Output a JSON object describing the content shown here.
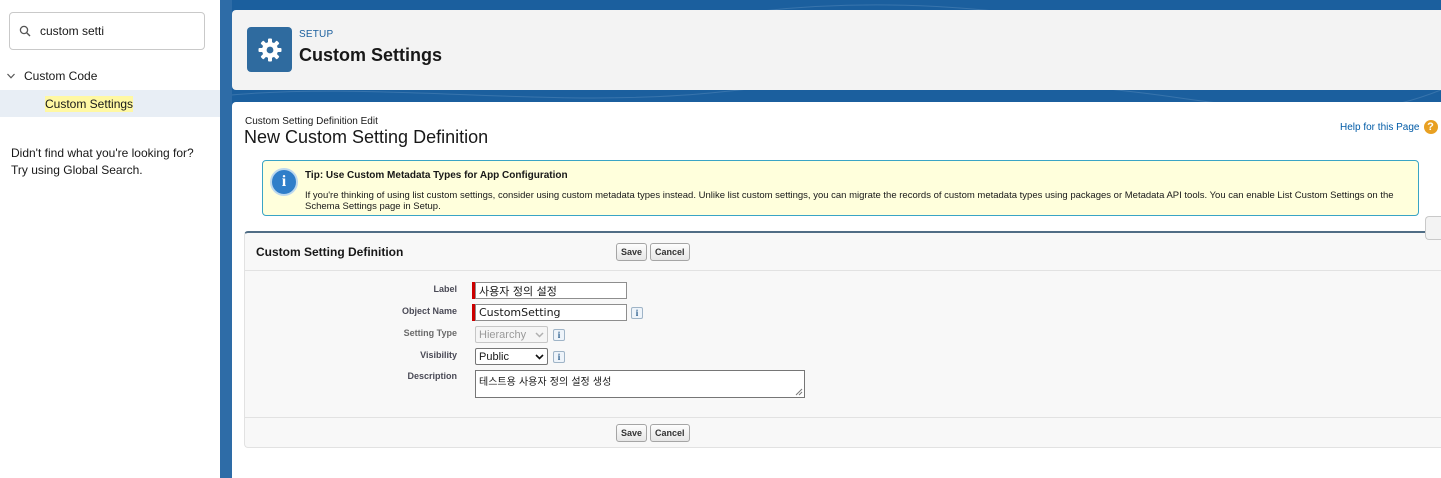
{
  "sidebar": {
    "search_value": "custom setti",
    "tree_parent_label": "Custom Code",
    "tree_child_label": "Custom Settings",
    "not_found_line1": "Didn't find what you're looking for?",
    "not_found_line2": "Try using Global Search."
  },
  "header": {
    "eyebrow": "SETUP",
    "title": "Custom Settings",
    "icon": "gear-icon"
  },
  "page": {
    "breadcrumb": "Custom Setting Definition Edit",
    "title": "New Custom Setting Definition",
    "help_link": "Help for this Page",
    "help_icon": "?"
  },
  "tip": {
    "title": "Tip: Use Custom Metadata Types for App Configuration",
    "text": "If you're thinking of using list custom settings, consider using custom metadata types instead. Unlike list custom settings, you can migrate the records of custom metadata types using packages or Metadata API tools. You can enable List Custom Settings on the Schema Settings page in Setup.",
    "icon_glyph": "i"
  },
  "form": {
    "section_title": "Custom Setting Definition",
    "save_label": "Save",
    "cancel_label": "Cancel",
    "fields": {
      "label": {
        "label": "Label",
        "value": "사용자 정의 설정"
      },
      "object_name": {
        "label": "Object Name",
        "value": "CustomSetting"
      },
      "setting_type": {
        "label": "Setting Type",
        "value": "Hierarchy"
      },
      "visibility": {
        "label": "Visibility",
        "value": "Public"
      },
      "description": {
        "label": "Description",
        "value": "테스트용 사용자 정의 설정 생성"
      }
    },
    "info_glyph": "i"
  },
  "colors": {
    "brand_blue": "#1b5f9e",
    "header_icon_bg": "#2f6b9f",
    "tip_bg": "#ffffdc",
    "tip_border": "#39a4c5",
    "required": "#cc0000",
    "help_icon": "#e8a022"
  }
}
